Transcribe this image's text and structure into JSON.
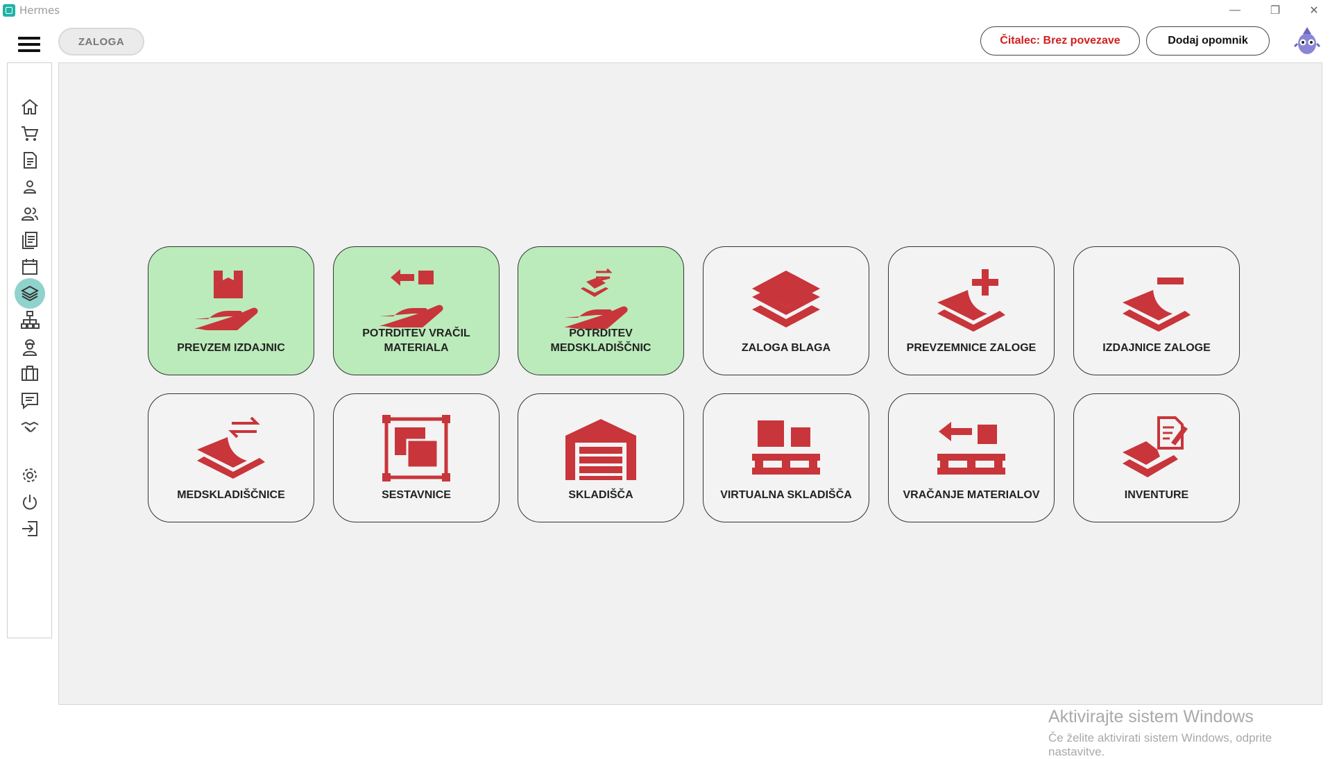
{
  "window": {
    "title": "Hermes"
  },
  "header": {
    "breadcrumb": "ZALOGA",
    "reader_status": "Čitalec: Brez povezave",
    "add_reminder": "Dodaj opomnik"
  },
  "sidebar": {
    "items": [
      {
        "icon": "home-icon"
      },
      {
        "icon": "cart-icon"
      },
      {
        "icon": "document-icon"
      },
      {
        "icon": "user-icon"
      },
      {
        "icon": "users-icon"
      },
      {
        "icon": "list-icon"
      },
      {
        "icon": "calendar-icon"
      },
      {
        "icon": "layers-icon",
        "active": true
      },
      {
        "icon": "network-icon"
      },
      {
        "icon": "worker-icon"
      },
      {
        "icon": "briefcase-icon"
      },
      {
        "icon": "chat-icon"
      },
      {
        "icon": "handshake-icon"
      },
      {
        "icon": "settings-icon"
      },
      {
        "icon": "power-icon"
      },
      {
        "icon": "logout-icon"
      }
    ]
  },
  "tiles": [
    {
      "label": "PREVZEM IZDAJNIC",
      "icon": "box-hand-icon",
      "highlight": true
    },
    {
      "label": "POTRDITEV VRAČIL MATERIALA",
      "icon": "return-hand-icon",
      "highlight": true
    },
    {
      "label": "POTRDITEV MEDSKLADIŠČNIC",
      "icon": "transfer-hand-icon",
      "highlight": true
    },
    {
      "label": "ZALOGA BLAGA",
      "icon": "stack-icon",
      "highlight": false
    },
    {
      "label": "PREVZEMNICE ZALOGE",
      "icon": "stack-plus-icon",
      "highlight": false
    },
    {
      "label": "IZDAJNICE ZALOGE",
      "icon": "stack-minus-icon",
      "highlight": false
    },
    {
      "label": "MEDSKLADIŠČNICE",
      "icon": "stack-transfer-icon",
      "highlight": false
    },
    {
      "label": "SESTAVNICE",
      "icon": "assembly-icon",
      "highlight": false
    },
    {
      "label": "SKLADIŠČA",
      "icon": "warehouse-icon",
      "highlight": false
    },
    {
      "label": "VIRTUALNA SKLADIŠČA",
      "icon": "pallet-icon",
      "highlight": false
    },
    {
      "label": "VRAČANJE MATERIALOV",
      "icon": "pallet-return-icon",
      "highlight": false
    },
    {
      "label": "INVENTURE",
      "icon": "stack-document-icon",
      "highlight": false
    }
  ],
  "watermark": {
    "line1": "Aktivirajte sistem Windows",
    "line2": "Če želite aktivirati sistem Windows, odprite nastavitve."
  },
  "colors": {
    "accent": "#c8353a",
    "tile_highlight": "#bbebbb",
    "active_nav": "#8fd3cc",
    "reader_text": "#d11d1d"
  }
}
